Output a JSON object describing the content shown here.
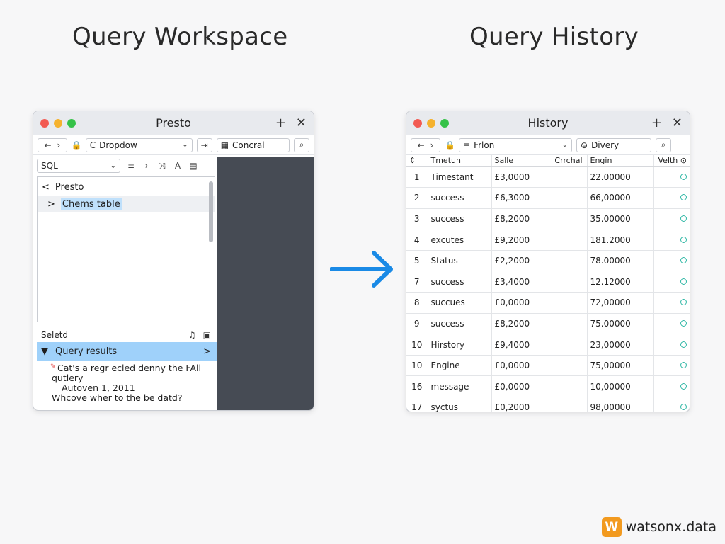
{
  "headings": {
    "left": "Query Workspace",
    "right": "Query History"
  },
  "workspace": {
    "title": "Presto",
    "toolbar": {
      "back": "←",
      "forward": "›",
      "lock": "🔒",
      "dropdown_prefix": "C",
      "dropdown_value": "Dropdow",
      "step_icon": "⇥",
      "connector_value": "Concral",
      "search_icon": "⌕"
    },
    "sql_select": "SQL",
    "toolbar2_icons": [
      "≡",
      "›",
      "⤨",
      "A",
      "▤"
    ],
    "tree": {
      "root_chevron": "<",
      "root": "Presto",
      "child_chevron": ">",
      "child": "Chems table"
    },
    "selected_label": "Seletd",
    "selected_icons": [
      "♫",
      "▣"
    ],
    "query_results": {
      "toggle": "▼",
      "label": "Query results",
      "chevron": ">"
    },
    "messages": {
      "line1": "Cat's a regr ecled denny the FAll",
      "line2": "qutlery",
      "line3": "Autoven 1, 2011",
      "line4": "Whcove wher to the be datd?"
    }
  },
  "history": {
    "title": "History",
    "toolbar": {
      "back": "←",
      "forward": "›",
      "lock": "🔒",
      "filter_icon": "≡",
      "filter_value": "Frlon",
      "delivery_icon": "⊜",
      "delivery_value": "Divery",
      "search_icon": "⌕"
    },
    "columns": [
      "⇕",
      "Tmetun",
      "Salle",
      "Crrchal",
      "Engin",
      "Velth ⊙"
    ],
    "rows": [
      {
        "idx": "1",
        "name": "Timestant",
        "value": "£3,0000",
        "engine": "22.00000"
      },
      {
        "idx": "2",
        "name": "success",
        "value": "£6,3000",
        "engine": "66,00000"
      },
      {
        "idx": "3",
        "name": "success",
        "value": "£8,2000",
        "engine": "35.00000"
      },
      {
        "idx": "4",
        "name": "excutes",
        "value": "£9,2000",
        "engine": "181.2000"
      },
      {
        "idx": "5",
        "name": "Status",
        "value": "£2,2000",
        "engine": "78.00000"
      },
      {
        "idx": "7",
        "name": "success",
        "value": "£3,4000",
        "engine": "12.12000"
      },
      {
        "idx": "8",
        "name": "succues",
        "value": "£0,0000",
        "engine": "72,00000"
      },
      {
        "idx": "9",
        "name": "success",
        "value": "£8,2000",
        "engine": "75.00000"
      },
      {
        "idx": "10",
        "name": "Hirstory",
        "value": "£9,4000",
        "engine": "23,00000"
      },
      {
        "idx": "10",
        "name": "Engine",
        "value": "£0,0000",
        "engine": "75,00000"
      },
      {
        "idx": "16",
        "name": "message",
        "value": "£0,0000",
        "engine": "10,00000"
      },
      {
        "idx": "17",
        "name": "syctus",
        "value": "£0,2000",
        "engine": "98,00000"
      }
    ]
  },
  "brand": {
    "logo_letter": "W",
    "name": "watsonx.data"
  },
  "colors": {
    "accent": "#1a8ae6",
    "selection": "#9fd1fa",
    "status_ok": "#2fb7a5"
  }
}
